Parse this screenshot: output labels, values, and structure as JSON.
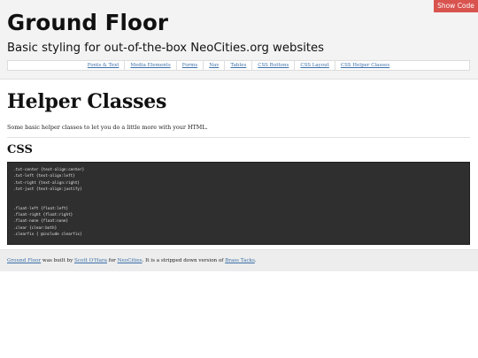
{
  "show_code_label": "Show Code",
  "header": {
    "title": "Ground Floor",
    "tagline": "Basic styling for out-of-the-box NeoCities.org websites"
  },
  "nav": {
    "items": [
      "Fonts & Text",
      "Media Elements",
      "Forms",
      "Nav",
      "Tables",
      "CSS Buttons",
      "CSS Layout",
      "CSS Helper Classes"
    ]
  },
  "main": {
    "title": "Helper Classes",
    "lead": "Some basic helper classes to let you do a little more with your HTML.",
    "section_heading": "CSS",
    "code_lines": [
      ".txt-center {text-align:center}",
      ".txt-left {text-align:left}",
      ".txt-right {text-align:right}",
      ".txt-just {text-align:justify}",
      "",
      "",
      ".float-left {float:left}",
      ".float-right {float:right}",
      ".float-none {float:none}",
      ".clear {clear:both}",
      ".clearfix { @include clearfix}"
    ]
  },
  "footer": {
    "link1": "Ground Floor",
    "text1": " was built by ",
    "link2": "Scott O'Hara",
    "text2": " for ",
    "link3": "NeoCities",
    "text3": ". It is a stripped down version of ",
    "link4": "Brass Tacks",
    "text4": "."
  }
}
